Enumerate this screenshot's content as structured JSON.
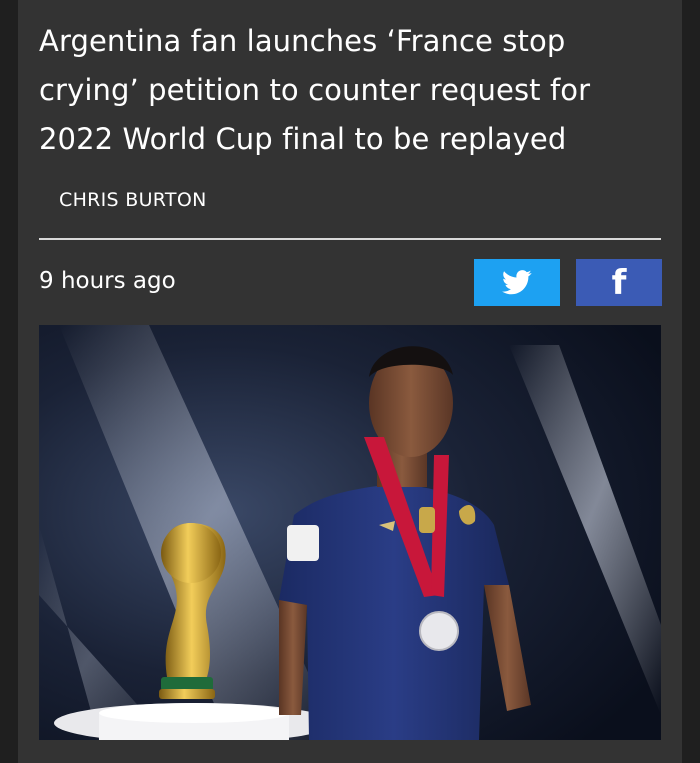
{
  "article": {
    "title": "Argentina fan launches ‘France stop crying’ petition to counter request for 2022 World Cup final to be replayed",
    "author": "CHRIS BURTON",
    "timestamp": "9 hours ago"
  },
  "share": {
    "twitter": {
      "icon": "twitter-bird-icon",
      "color": "#1da1f2"
    },
    "facebook": {
      "icon": "facebook-f-icon",
      "label": "f",
      "color": "#3b5bb5"
    }
  },
  "photo": {
    "subject": "player-with-trophy-photo"
  }
}
